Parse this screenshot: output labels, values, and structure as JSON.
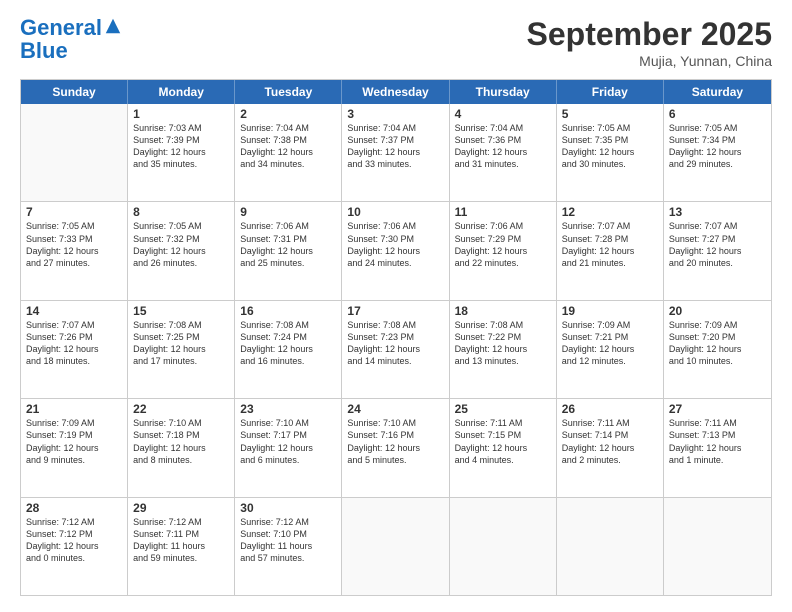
{
  "header": {
    "logo_line1": "General",
    "logo_line2": "Blue",
    "month": "September 2025",
    "location": "Mujia, Yunnan, China"
  },
  "calendar": {
    "days_of_week": [
      "Sunday",
      "Monday",
      "Tuesday",
      "Wednesday",
      "Thursday",
      "Friday",
      "Saturday"
    ],
    "weeks": [
      [
        {
          "day": "",
          "info": ""
        },
        {
          "day": "1",
          "info": "Sunrise: 7:03 AM\nSunset: 7:39 PM\nDaylight: 12 hours\nand 35 minutes."
        },
        {
          "day": "2",
          "info": "Sunrise: 7:04 AM\nSunset: 7:38 PM\nDaylight: 12 hours\nand 34 minutes."
        },
        {
          "day": "3",
          "info": "Sunrise: 7:04 AM\nSunset: 7:37 PM\nDaylight: 12 hours\nand 33 minutes."
        },
        {
          "day": "4",
          "info": "Sunrise: 7:04 AM\nSunset: 7:36 PM\nDaylight: 12 hours\nand 31 minutes."
        },
        {
          "day": "5",
          "info": "Sunrise: 7:05 AM\nSunset: 7:35 PM\nDaylight: 12 hours\nand 30 minutes."
        },
        {
          "day": "6",
          "info": "Sunrise: 7:05 AM\nSunset: 7:34 PM\nDaylight: 12 hours\nand 29 minutes."
        }
      ],
      [
        {
          "day": "7",
          "info": "Sunrise: 7:05 AM\nSunset: 7:33 PM\nDaylight: 12 hours\nand 27 minutes."
        },
        {
          "day": "8",
          "info": "Sunrise: 7:05 AM\nSunset: 7:32 PM\nDaylight: 12 hours\nand 26 minutes."
        },
        {
          "day": "9",
          "info": "Sunrise: 7:06 AM\nSunset: 7:31 PM\nDaylight: 12 hours\nand 25 minutes."
        },
        {
          "day": "10",
          "info": "Sunrise: 7:06 AM\nSunset: 7:30 PM\nDaylight: 12 hours\nand 24 minutes."
        },
        {
          "day": "11",
          "info": "Sunrise: 7:06 AM\nSunset: 7:29 PM\nDaylight: 12 hours\nand 22 minutes."
        },
        {
          "day": "12",
          "info": "Sunrise: 7:07 AM\nSunset: 7:28 PM\nDaylight: 12 hours\nand 21 minutes."
        },
        {
          "day": "13",
          "info": "Sunrise: 7:07 AM\nSunset: 7:27 PM\nDaylight: 12 hours\nand 20 minutes."
        }
      ],
      [
        {
          "day": "14",
          "info": "Sunrise: 7:07 AM\nSunset: 7:26 PM\nDaylight: 12 hours\nand 18 minutes."
        },
        {
          "day": "15",
          "info": "Sunrise: 7:08 AM\nSunset: 7:25 PM\nDaylight: 12 hours\nand 17 minutes."
        },
        {
          "day": "16",
          "info": "Sunrise: 7:08 AM\nSunset: 7:24 PM\nDaylight: 12 hours\nand 16 minutes."
        },
        {
          "day": "17",
          "info": "Sunrise: 7:08 AM\nSunset: 7:23 PM\nDaylight: 12 hours\nand 14 minutes."
        },
        {
          "day": "18",
          "info": "Sunrise: 7:08 AM\nSunset: 7:22 PM\nDaylight: 12 hours\nand 13 minutes."
        },
        {
          "day": "19",
          "info": "Sunrise: 7:09 AM\nSunset: 7:21 PM\nDaylight: 12 hours\nand 12 minutes."
        },
        {
          "day": "20",
          "info": "Sunrise: 7:09 AM\nSunset: 7:20 PM\nDaylight: 12 hours\nand 10 minutes."
        }
      ],
      [
        {
          "day": "21",
          "info": "Sunrise: 7:09 AM\nSunset: 7:19 PM\nDaylight: 12 hours\nand 9 minutes."
        },
        {
          "day": "22",
          "info": "Sunrise: 7:10 AM\nSunset: 7:18 PM\nDaylight: 12 hours\nand 8 minutes."
        },
        {
          "day": "23",
          "info": "Sunrise: 7:10 AM\nSunset: 7:17 PM\nDaylight: 12 hours\nand 6 minutes."
        },
        {
          "day": "24",
          "info": "Sunrise: 7:10 AM\nSunset: 7:16 PM\nDaylight: 12 hours\nand 5 minutes."
        },
        {
          "day": "25",
          "info": "Sunrise: 7:11 AM\nSunset: 7:15 PM\nDaylight: 12 hours\nand 4 minutes."
        },
        {
          "day": "26",
          "info": "Sunrise: 7:11 AM\nSunset: 7:14 PM\nDaylight: 12 hours\nand 2 minutes."
        },
        {
          "day": "27",
          "info": "Sunrise: 7:11 AM\nSunset: 7:13 PM\nDaylight: 12 hours\nand 1 minute."
        }
      ],
      [
        {
          "day": "28",
          "info": "Sunrise: 7:12 AM\nSunset: 7:12 PM\nDaylight: 12 hours\nand 0 minutes."
        },
        {
          "day": "29",
          "info": "Sunrise: 7:12 AM\nSunset: 7:11 PM\nDaylight: 11 hours\nand 59 minutes."
        },
        {
          "day": "30",
          "info": "Sunrise: 7:12 AM\nSunset: 7:10 PM\nDaylight: 11 hours\nand 57 minutes."
        },
        {
          "day": "",
          "info": ""
        },
        {
          "day": "",
          "info": ""
        },
        {
          "day": "",
          "info": ""
        },
        {
          "day": "",
          "info": ""
        }
      ]
    ]
  }
}
